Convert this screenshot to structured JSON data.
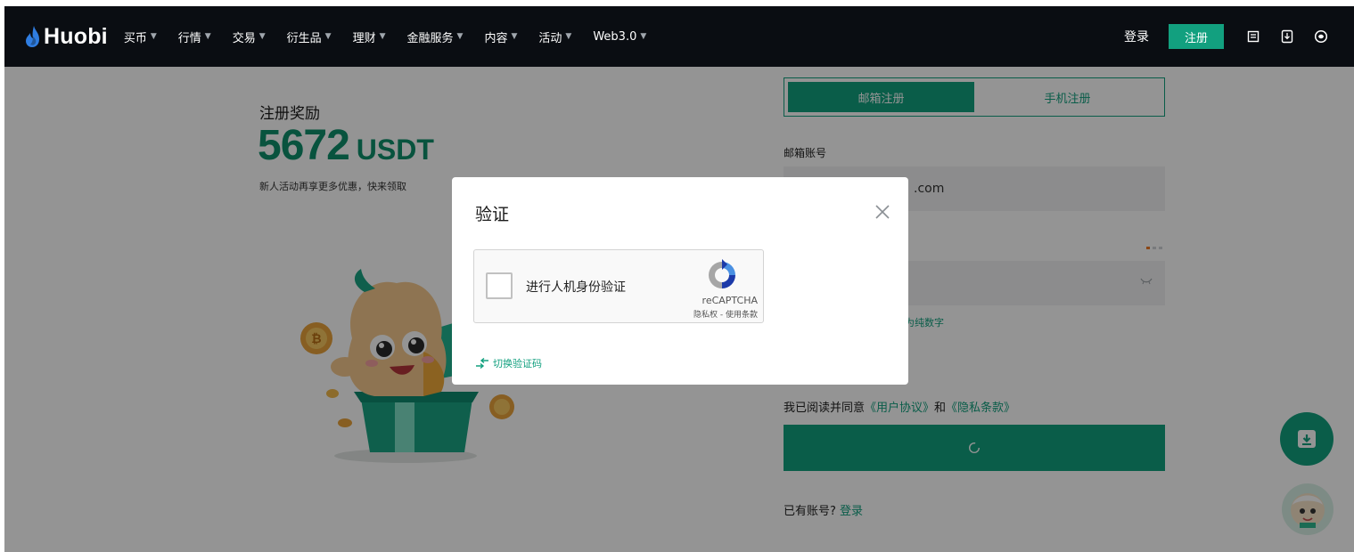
{
  "brand": {
    "name": "Huobi",
    "accent": "#12a07f"
  },
  "nav": {
    "menu": [
      {
        "label": "买币"
      },
      {
        "label": "行情"
      },
      {
        "label": "交易"
      },
      {
        "label": "衍生品"
      },
      {
        "label": "理财"
      },
      {
        "label": "金融服务"
      },
      {
        "label": "内容"
      },
      {
        "label": "活动"
      },
      {
        "label": "Web3.0"
      }
    ],
    "login": "登录",
    "signup": "注册",
    "icons": [
      "orders-icon",
      "download-icon",
      "language-icon"
    ]
  },
  "promo": {
    "label": "注册奖励",
    "amount": "5672",
    "unit": "USDT",
    "subtitle": "新人活动再享更多优惠，快来领取"
  },
  "form": {
    "tabs": [
      {
        "label": "邮箱注册",
        "active": true
      },
      {
        "label": "手机注册",
        "active": false
      }
    ],
    "email_label": "邮箱账号",
    "email_value": ".com",
    "password_strength": 1,
    "password_hint": "为纯数字",
    "agree": {
      "prefix": "我已阅读并同意",
      "terms": "《用户协议》",
      "and": "和",
      "privacy": "《隐私条款》"
    },
    "have_account": {
      "text": "已有账号?",
      "login": "登录"
    }
  },
  "modal": {
    "title": "验证",
    "recaptcha": {
      "label": "进行人机身份验证",
      "brand": "reCAPTCHA",
      "terms": "隐私权 - 使用条款"
    },
    "switch_label": "切换验证码"
  }
}
